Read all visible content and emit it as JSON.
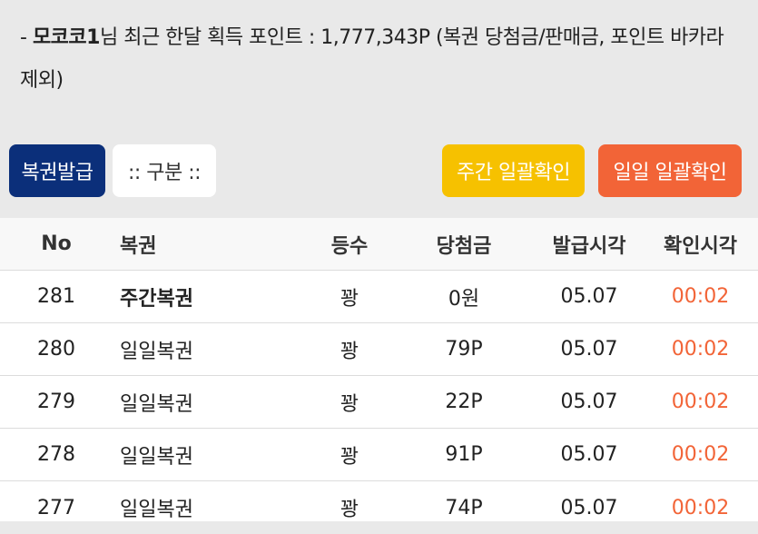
{
  "notice": {
    "prefix": "- ",
    "username": "모코코1",
    "text": "님 최근 한달 획득 포인트 : 1,777,343P (복권 당첨금/판매금, 포인트 바카라 제외)"
  },
  "toolbar": {
    "issue_label": "복권발급",
    "category_label": ":: 구분 ::",
    "weekly_confirm_label": "주간 일괄확인",
    "daily_confirm_label": "일일 일괄확인"
  },
  "table": {
    "headers": {
      "no": "No",
      "ticket": "복권",
      "rank": "등수",
      "prize": "당첨금",
      "issued": "발급시각",
      "confirmed": "확인시각"
    },
    "rows": [
      {
        "no": "281",
        "ticket": "주간복권",
        "rank": "꽝",
        "prize": "0원",
        "issued": "05.07",
        "confirmed": "00:02"
      },
      {
        "no": "280",
        "ticket": "일일복권",
        "rank": "꽝",
        "prize": "79P",
        "issued": "05.07",
        "confirmed": "00:02"
      },
      {
        "no": "279",
        "ticket": "일일복권",
        "rank": "꽝",
        "prize": "22P",
        "issued": "05.07",
        "confirmed": "00:02"
      },
      {
        "no": "278",
        "ticket": "일일복권",
        "rank": "꽝",
        "prize": "91P",
        "issued": "05.07",
        "confirmed": "00:02"
      },
      {
        "no": "277",
        "ticket": "일일복권",
        "rank": "꽝",
        "prize": "74P",
        "issued": "05.07",
        "confirmed": "00:02"
      }
    ]
  },
  "colors": {
    "issue_button": "#0b2f7a",
    "weekly_button": "#f6c100",
    "daily_button": "#f26437",
    "confirmed_time": "#f26437"
  }
}
